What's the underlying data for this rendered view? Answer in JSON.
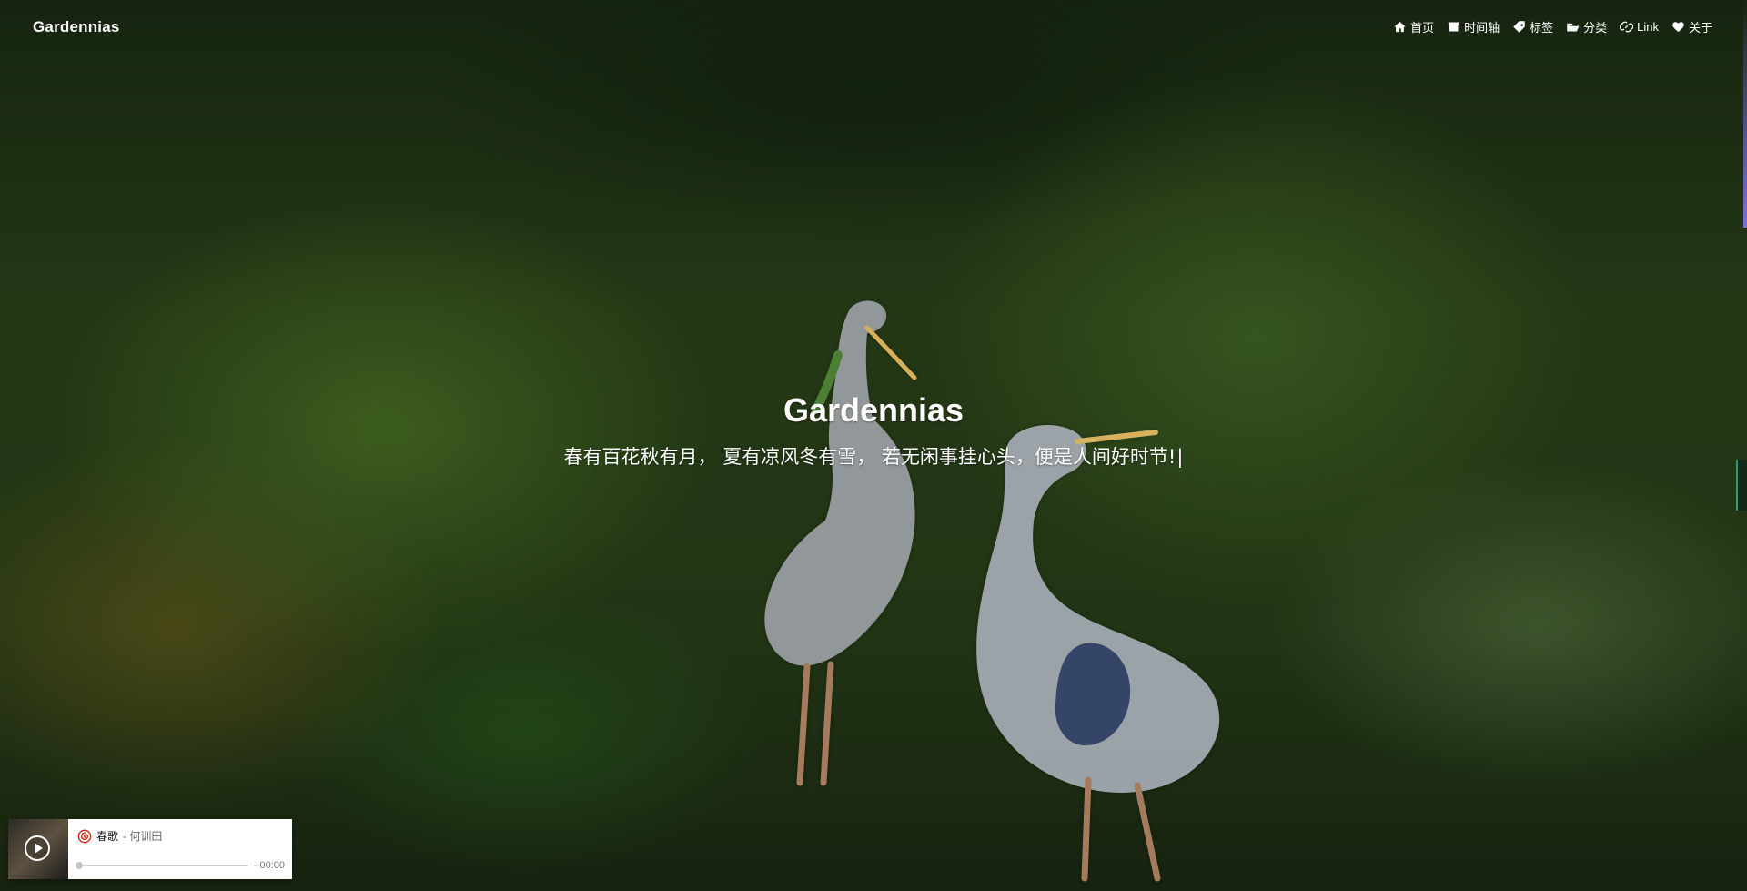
{
  "site": {
    "brand": "Gardennias",
    "nav": [
      {
        "icon": "home-icon",
        "label": "首页"
      },
      {
        "icon": "archive-icon",
        "label": "时间轴"
      },
      {
        "icon": "tags-icon",
        "label": "标签"
      },
      {
        "icon": "folder-open-icon",
        "label": "分类"
      },
      {
        "icon": "link-icon",
        "label": "Link"
      },
      {
        "icon": "heart-icon",
        "label": "关于"
      }
    ]
  },
  "hero": {
    "title": "Gardennias",
    "subtitle": "春有百花秋有月， 夏有凉风冬有雪， 若无闲事挂心头，便是人间好时节!",
    "caret": "|"
  },
  "player": {
    "song": "春歌",
    "separator": " - ",
    "artist": "何训田",
    "time": "- 00:00",
    "progress": 0
  }
}
